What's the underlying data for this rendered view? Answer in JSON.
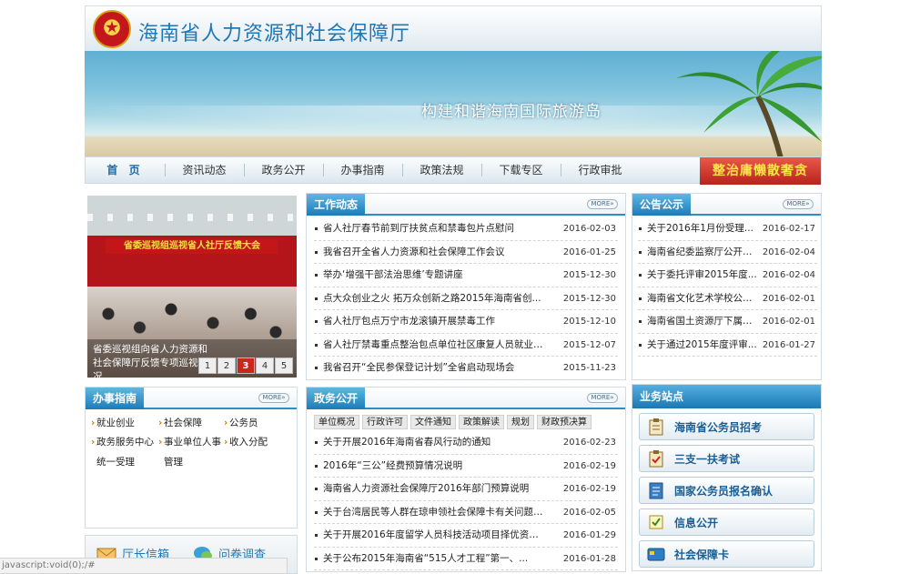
{
  "header": {
    "site_title": "海南省人力资源和社会保障厅",
    "emblem_icon": "national-emblem-icon"
  },
  "banner": {
    "slogan": "构建和谐海南国际旅游岛"
  },
  "nav": {
    "items": [
      "首 页",
      "资讯动态",
      "政务公开",
      "办事指南",
      "政策法规",
      "下载专区",
      "行政审批"
    ],
    "promo": "整治庸懒散奢贪"
  },
  "more_label": "MORE»",
  "slideshow": {
    "stage_banner": "省委巡视组巡视省人社厅反馈大会",
    "caption": "省委巡视组向省人力资源和社会保障厅反馈专项巡视情况",
    "pages": [
      "1",
      "2",
      "3",
      "4",
      "5"
    ],
    "active_page": "3"
  },
  "work_news": {
    "title": "工作动态",
    "items": [
      {
        "title": "省人社厅春节前到厅扶贫点和禁毒包片点慰问",
        "date": "2016-02-03"
      },
      {
        "title": "我省召开全省人力资源和社会保障工作会议",
        "date": "2016-01-25"
      },
      {
        "title": "举办‘增强干部法治思维’专题讲座",
        "date": "2015-12-30"
      },
      {
        "title": "点大众创业之火  拓万众创新之路2015年海南省创...",
        "date": "2015-12-30"
      },
      {
        "title": "省人社厅包点万宁市龙滚镇开展禁毒工作",
        "date": "2015-12-10"
      },
      {
        "title": "省人社厅禁毒重点整治包点单位社区康复人员就业培训第...",
        "date": "2015-12-07"
      },
      {
        "title": "我省召开“全民参保登记计划”全省启动现场会",
        "date": "2015-11-23"
      }
    ]
  },
  "notices": {
    "title": "公告公示",
    "items": [
      {
        "title": "关于2016年1月份受理...",
        "date": "2016-02-17"
      },
      {
        "title": "海南省纪委监察厅公开招聘...",
        "date": "2016-02-04"
      },
      {
        "title": "关于委托评审2015年度...",
        "date": "2016-02-04"
      },
      {
        "title": "海南省文化艺术学校公开招...",
        "date": "2016-02-01"
      },
      {
        "title": "海南省国土资源厅下属事业...",
        "date": "2016-02-01"
      },
      {
        "title": "关于通过2015年度评审...",
        "date": "2016-01-27"
      }
    ]
  },
  "guide": {
    "title": "办事指南",
    "links": [
      "就业创业",
      "社会保障",
      "公务员",
      "政务服务中心",
      "事业单位人事",
      "收入分配",
      "统一受理",
      "管理",
      ""
    ]
  },
  "gov_open": {
    "title": "政务公开",
    "tags": [
      "单位概况",
      "行政许可",
      "文件通知",
      "政策解读",
      "规划",
      "财政预决算"
    ],
    "items": [
      {
        "title": "关于开展2016年海南省春风行动的通知",
        "date": "2016-02-23"
      },
      {
        "title": "2016年“三公”经费预算情况说明",
        "date": "2016-02-19"
      },
      {
        "title": "海南省人力资源社会保障厅2016年部门预算说明",
        "date": "2016-02-19"
      },
      {
        "title": "关于台湾居民等人群在琼申领社会保障卡有关问题的...",
        "date": "2016-02-05"
      },
      {
        "title": "关于开展2016年度留学人员科技活动项目择优资助...",
        "date": "2016-01-29"
      },
      {
        "title": "关于公布2015年海南省“515人才工程”第一、...",
        "date": "2016-01-28"
      }
    ]
  },
  "mailbox": {
    "director_mail": "厅长信箱",
    "survey": "问卷调查"
  },
  "station": {
    "title": "业务站点",
    "items": [
      {
        "label": "海南省公务员招考",
        "icon": "clipboard-icon"
      },
      {
        "label": "三支一扶考试",
        "icon": "clipboard-check-icon"
      },
      {
        "label": "国家公务员报名确认",
        "icon": "document-icon"
      },
      {
        "label": "信息公开",
        "icon": "checkbox-icon"
      },
      {
        "label": "社会保障卡",
        "icon": "card-icon"
      }
    ]
  },
  "status_bar": "javascript:void(0);/#",
  "colors": {
    "brand_blue": "#1f78b4",
    "accent_red": "#c8271c",
    "promo_yellow": "#ffe34a"
  }
}
